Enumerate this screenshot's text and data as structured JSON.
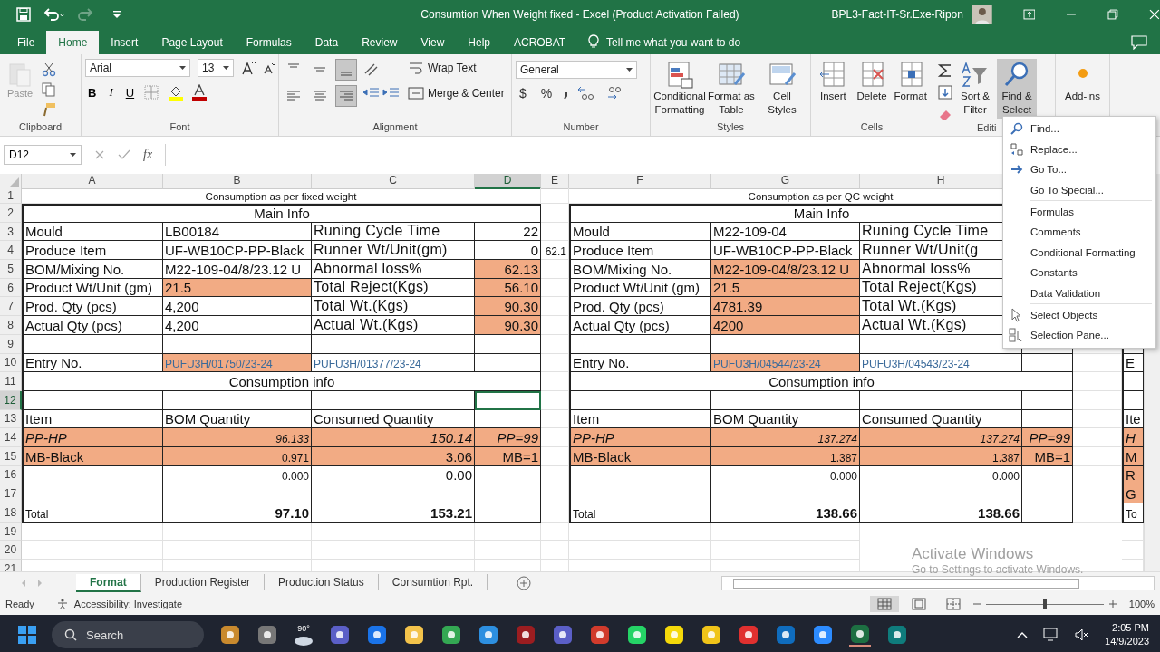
{
  "window": {
    "title": "Consumtion When Weight fixed  -  Excel (Product Activation Failed)",
    "user": "BPL3-Fact-IT-Sr.Exe-Ripon"
  },
  "quick_access": {
    "redo_disabled": true
  },
  "menu_tabs": [
    {
      "label": "File",
      "selected": false
    },
    {
      "label": "Home",
      "selected": true
    },
    {
      "label": "Insert",
      "selected": false
    },
    {
      "label": "Page Layout",
      "selected": false
    },
    {
      "label": "Formulas",
      "selected": false
    },
    {
      "label": "Data",
      "selected": false
    },
    {
      "label": "Review",
      "selected": false
    },
    {
      "label": "View",
      "selected": false
    },
    {
      "label": "Help",
      "selected": false
    },
    {
      "label": "ACROBAT",
      "selected": false
    }
  ],
  "tell_me": {
    "placeholder": "Tell me what you want to do"
  },
  "ribbon": {
    "clipboard": {
      "label": "Clipboard",
      "paste": "Paste",
      "paste_disabled": true
    },
    "font": {
      "label": "Font",
      "font_name": "Arial",
      "font_size": "13",
      "bold": "B",
      "italic": "I",
      "underline": "U"
    },
    "alignment": {
      "label": "Alignment",
      "wrap_text": "Wrap Text",
      "merge_center": "Merge & Center",
      "buttons": [
        {
          "kind": "top",
          "selected": false
        },
        {
          "kind": "middle",
          "selected": false
        },
        {
          "kind": "bottom",
          "selected": true
        },
        {
          "kind": "left",
          "selected": false
        },
        {
          "kind": "center",
          "selected": false
        },
        {
          "kind": "right",
          "selected": true
        }
      ]
    },
    "number": {
      "label": "Number",
      "format": "General",
      "currency": "$",
      "percent": "%"
    },
    "styles": {
      "label": "Styles",
      "buttons": [
        "Conditional Formatting",
        "Format as Table",
        "Cell Styles"
      ]
    },
    "cells": {
      "label": "Cells",
      "buttons": [
        "Insert",
        "Delete",
        "Format"
      ]
    },
    "editing": {
      "label": "Editi",
      "buttons": [
        {
          "label": "Sort & Filter",
          "selected": false
        },
        {
          "label": "Find & Select",
          "selected": true
        }
      ]
    },
    "addins": {
      "label": "Add-ins"
    }
  },
  "formula_bar": {
    "name_box": "D12",
    "fx": "fx"
  },
  "sheet": {
    "columns": [
      {
        "label": "A",
        "selected": false
      },
      {
        "label": "B",
        "selected": false
      },
      {
        "label": "C",
        "selected": false
      },
      {
        "label": "D",
        "selected": true
      },
      {
        "label": "E",
        "selected": false
      },
      {
        "label": "F",
        "selected": false
      },
      {
        "label": "G",
        "selected": false
      },
      {
        "label": "H",
        "selected": false
      }
    ],
    "rows": [
      {
        "label": "1",
        "selected": false,
        "cells": [
          {
            "text": "Consumption as per fixed weight",
            "kind": "caption"
          },
          "",
          {
            "text": "Consumption as per QC weight",
            "kind": "caption"
          }
        ]
      },
      {
        "label": "2",
        "selected": false,
        "cells": [
          {
            "text": "Main Info",
            "kind": "heading"
          },
          "",
          {
            "text": "Main Info",
            "kind": "heading"
          }
        ]
      },
      {
        "label": "3",
        "selected": false,
        "cells": [
          {
            "text": "Mould",
            "kind": "label"
          },
          {
            "text": "LB00184",
            "kind": "label"
          },
          {
            "text": "Runing Cycle Time",
            "kind": "wide"
          },
          {
            "text": "22",
            "kind": "number"
          },
          "",
          {
            "text": "Mould",
            "kind": "label"
          },
          {
            "text": "M22-109-04",
            "kind": "label"
          },
          {
            "text": "Runing Cycle Time",
            "kind": "wide"
          }
        ]
      },
      {
        "label": "4",
        "selected": false,
        "cells": [
          {
            "text": "Produce Item",
            "kind": "label"
          },
          {
            "text": "UF-WB10CP-PP-Black",
            "kind": "label"
          },
          {
            "text": "Runner Wt/Unit(gm)",
            "kind": "wide"
          },
          {
            "text": "0",
            "kind": "number"
          },
          {
            "text": "62.1",
            "kind": "small"
          },
          {
            "text": "Produce Item",
            "kind": "label"
          },
          {
            "text": "UF-WB10CP-PP-Black",
            "kind": "label"
          },
          {
            "text": "Runner Wt/Unit(g",
            "kind": "wide"
          }
        ]
      },
      {
        "label": "5",
        "selected": false,
        "cells": [
          {
            "text": "BOM/Mixing No.",
            "kind": "label"
          },
          {
            "text": "M22-109-04/8/23.12 U",
            "kind": "label"
          },
          {
            "text": "Abnormal loss%",
            "kind": "wide"
          },
          {
            "text": "62.13",
            "kind": "number",
            "fill": true
          },
          "",
          {
            "text": "BOM/Mixing No.",
            "kind": "label"
          },
          {
            "text": "M22-109-04/8/23.12 U",
            "kind": "label",
            "fill": true
          },
          {
            "text": "Abnormal loss%",
            "kind": "wide"
          }
        ]
      },
      {
        "label": "6",
        "selected": false,
        "cells": [
          {
            "text": "Product Wt/Unit (gm)",
            "kind": "label"
          },
          {
            "text": "21.5",
            "kind": "label",
            "fill": true
          },
          {
            "text": "Total Reject(Kgs)",
            "kind": "wide"
          },
          {
            "text": "56.10",
            "kind": "number",
            "fill": true
          },
          "",
          {
            "text": "Product Wt/Unit (gm)",
            "kind": "label"
          },
          {
            "text": "21.5",
            "kind": "label",
            "fill": true
          },
          {
            "text": "Total Reject(Kgs)",
            "kind": "wide"
          }
        ]
      },
      {
        "label": "7",
        "selected": false,
        "cells": [
          {
            "text": "Prod. Qty (pcs)",
            "kind": "label"
          },
          {
            "text": "4,200",
            "kind": "label"
          },
          {
            "text": "Total Wt.(Kgs)",
            "kind": "wide"
          },
          {
            "text": "90.30",
            "kind": "number",
            "fill": true
          },
          "",
          {
            "text": "Prod. Qty (pcs)",
            "kind": "label"
          },
          {
            "text": "4781.39",
            "kind": "label",
            "fill": true
          },
          {
            "text": "Total Wt.(Kgs)",
            "kind": "wide"
          }
        ]
      },
      {
        "label": "8",
        "selected": false,
        "cells": [
          {
            "text": "Actual Qty (pcs)",
            "kind": "label"
          },
          {
            "text": "4,200",
            "kind": "label"
          },
          {
            "text": "Actual Wt.(Kgs)",
            "kind": "wide"
          },
          {
            "text": "90.30",
            "kind": "number",
            "fill": true
          },
          "",
          {
            "text": "Actual Qty (pcs)",
            "kind": "label"
          },
          {
            "text": "4200",
            "kind": "label",
            "fill": true
          },
          {
            "text": "Actual Wt.(Kgs)",
            "kind": "wide"
          }
        ]
      },
      {
        "label": "9",
        "selected": false
      },
      {
        "label": "10",
        "selected": false,
        "cells": [
          {
            "text": "Entry No.",
            "kind": "label"
          },
          {
            "text": "PUFU3H/01750/23-24",
            "kind": "link",
            "fill": true
          },
          {
            "text": "PUFU3H/01377/23-24",
            "kind": "link"
          },
          "",
          "",
          {
            "text": "Entry No.",
            "kind": "label"
          },
          {
            "text": "PUFU3H/04544/23-24",
            "kind": "link",
            "fill": true
          },
          {
            "text": "PUFU3H/04543/23-24",
            "kind": "link"
          },
          "",
          "",
          {
            "text": "E",
            "kind": "label"
          }
        ]
      },
      {
        "label": "11",
        "selected": false,
        "cells": [
          {
            "text": "Consumption info",
            "kind": "heading"
          },
          "",
          {
            "text": "Consumption info",
            "kind": "heading"
          }
        ]
      },
      {
        "label": "12",
        "selected": true
      },
      {
        "label": "13",
        "selected": false,
        "cells": [
          {
            "text": "Item",
            "kind": "label"
          },
          {
            "text": "BOM Quantity",
            "kind": "label"
          },
          {
            "text": "Consumed Quantity",
            "kind": "label"
          },
          "",
          "",
          {
            "text": "Item",
            "kind": "label"
          },
          {
            "text": "BOM Quantity",
            "kind": "label"
          },
          {
            "text": "Consumed Quantity",
            "kind": "label"
          },
          "",
          "",
          {
            "text": "Ite",
            "kind": "label"
          }
        ]
      },
      {
        "label": "14",
        "selected": false,
        "cells": [
          {
            "text": "PP-HP",
            "kind": "label",
            "italic": true,
            "fill": true
          },
          {
            "text": "96.133",
            "kind": "small",
            "italic": true,
            "fill": true
          },
          {
            "text": "150.14",
            "kind": "number",
            "italic": true,
            "fill": true
          },
          {
            "text": "PP=99",
            "kind": "number",
            "italic": true,
            "fill": true
          },
          "",
          {
            "text": "PP-HP",
            "kind": "label",
            "italic": true,
            "fill": true
          },
          {
            "text": "137.274",
            "kind": "small",
            "italic": true,
            "fill": true
          },
          {
            "text": "137.274",
            "kind": "small",
            "italic": true,
            "fill": true
          },
          {
            "text": "PP=99",
            "kind": "number",
            "italic": true,
            "fill": true
          },
          "",
          {
            "text": "H",
            "kind": "label",
            "italic": true,
            "fill": true
          }
        ]
      },
      {
        "label": "15",
        "selected": false,
        "cells": [
          {
            "text": "MB-Black",
            "kind": "label",
            "fill": true
          },
          {
            "text": "0.971",
            "kind": "small",
            "fill": true
          },
          {
            "text": "3.06",
            "kind": "number",
            "fill": true
          },
          {
            "text": "MB=1",
            "kind": "number",
            "fill": true
          },
          "",
          {
            "text": "MB-Black",
            "kind": "label",
            "fill": true
          },
          {
            "text": "1.387",
            "kind": "small",
            "fill": true
          },
          {
            "text": "1.387",
            "kind": "small",
            "fill": true
          },
          {
            "text": "MB=1",
            "kind": "number",
            "fill": true
          },
          "",
          {
            "text": "M",
            "kind": "label",
            "fill": true
          }
        ]
      },
      {
        "label": "16",
        "selected": false,
        "cells": [
          "",
          {
            "text": "0.000",
            "kind": "small"
          },
          {
            "text": "0.00",
            "kind": "number"
          },
          "",
          "",
          "",
          {
            "text": "0.000",
            "kind": "small"
          },
          {
            "text": "0.000",
            "kind": "small"
          },
          "",
          "",
          {
            "text": "R",
            "kind": "label",
            "fill": true
          }
        ]
      },
      {
        "label": "17",
        "selected": false,
        "cells": [
          "",
          "",
          "",
          "",
          "",
          "",
          "",
          "",
          "",
          "",
          {
            "text": "G",
            "kind": "label",
            "fill": true
          }
        ]
      },
      {
        "label": "18",
        "selected": false,
        "cells": [
          {
            "text": "Total",
            "kind": "total"
          },
          {
            "text": "97.10",
            "kind": "number",
            "bold": true
          },
          {
            "text": "153.21",
            "kind": "number",
            "bold": true
          },
          "",
          "",
          {
            "text": "Total",
            "kind": "total"
          },
          {
            "text": "138.66",
            "kind": "number",
            "bold": true
          },
          {
            "text": "138.66",
            "kind": "number",
            "bold": true
          },
          "",
          "",
          {
            "text": "To",
            "kind": "total"
          }
        ]
      },
      {
        "label": "19",
        "selected": false
      },
      {
        "label": "20",
        "selected": false
      },
      {
        "label": "21",
        "selected": false
      }
    ]
  },
  "find_menu": [
    {
      "kind": "find",
      "label": "Find..."
    },
    {
      "kind": "replace",
      "label": "Replace..."
    },
    {
      "kind": "goto",
      "label": "Go To..."
    },
    {
      "kind": "plain",
      "label": "Go To Special..."
    },
    {
      "kind": "separator"
    },
    {
      "kind": "plain",
      "label": "Formulas"
    },
    {
      "kind": "plain",
      "label": "Comments"
    },
    {
      "kind": "plain",
      "label": "Conditional Formatting"
    },
    {
      "kind": "plain",
      "label": "Constants"
    },
    {
      "kind": "plain",
      "label": "Data Validation"
    },
    {
      "kind": "separator"
    },
    {
      "kind": "select",
      "label": "Select Objects"
    },
    {
      "kind": "pane",
      "label": "Selection Pane..."
    }
  ],
  "sheet_tabs": [
    {
      "label": "Format",
      "selected": true
    },
    {
      "label": "Production Register",
      "selected": false
    },
    {
      "label": "Production Status",
      "selected": false
    },
    {
      "label": "Consumtion Rpt.",
      "selected": false
    }
  ],
  "activation_notice": {
    "title": "Activate Windows",
    "hint": "Go to Settings to activate Windows."
  },
  "status_bar": {
    "mode": "Ready",
    "accessibility": "Accessibility: Investigate",
    "zoom": "100%",
    "zoom_level": {
      "level": 0.5
    }
  },
  "taskbar": {
    "search": {
      "placeholder": "Search"
    },
    "weather": "90°",
    "time": "2:05 PM",
    "date": "14/9/2023"
  }
}
